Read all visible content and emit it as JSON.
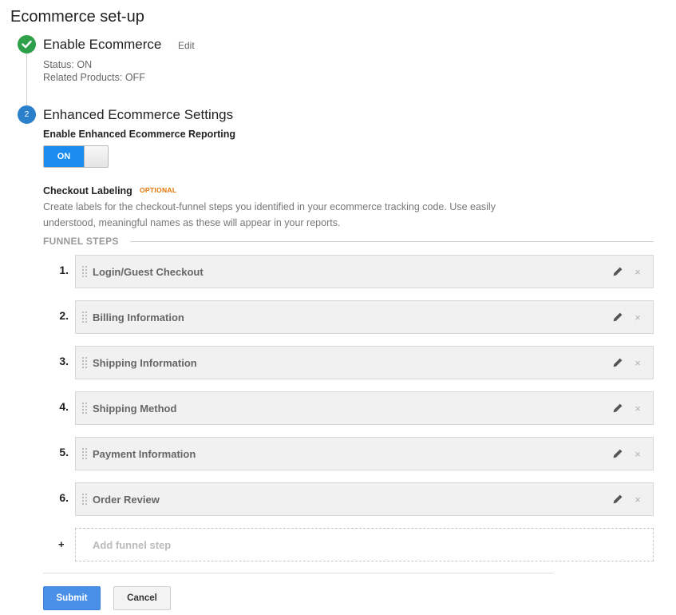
{
  "page": {
    "title": "Ecommerce set-up"
  },
  "step1": {
    "title": "Enable Ecommerce",
    "edit_label": "Edit",
    "status_line": "Status: ON",
    "related_line": "Related Products: OFF",
    "icon": "check-icon",
    "color": "#2ea04a"
  },
  "step2": {
    "number": "2",
    "title": "Enhanced Ecommerce Settings",
    "color": "#2b80cc",
    "reporting_label": "Enable Enhanced Ecommerce Reporting",
    "toggle": {
      "label": "ON",
      "state": true,
      "color": "#1a8cf0"
    }
  },
  "checkout": {
    "label": "Checkout Labeling",
    "optional_tag": "OPTIONAL",
    "description": "Create labels for the checkout-funnel steps you identified in your ecommerce tracking code. Use easily understood, meaningful names as these will appear in your reports."
  },
  "funnel": {
    "heading": "FUNNEL STEPS",
    "steps": [
      {
        "number": "1.",
        "label": "Login/Guest Checkout"
      },
      {
        "number": "2.",
        "label": "Billing Information"
      },
      {
        "number": "3.",
        "label": "Shipping Information"
      },
      {
        "number": "4.",
        "label": "Shipping Method"
      },
      {
        "number": "5.",
        "label": "Payment Information"
      },
      {
        "number": "6.",
        "label": "Order Review"
      }
    ],
    "add_symbol": "+",
    "add_label": "Add funnel step",
    "icons": {
      "drag": "drag-handle-icon",
      "edit": "pencil-icon",
      "remove": "close-icon"
    },
    "remove_glyph": "×"
  },
  "actions": {
    "submit": "Submit",
    "cancel": "Cancel",
    "submit_color": "#4a90e8"
  }
}
